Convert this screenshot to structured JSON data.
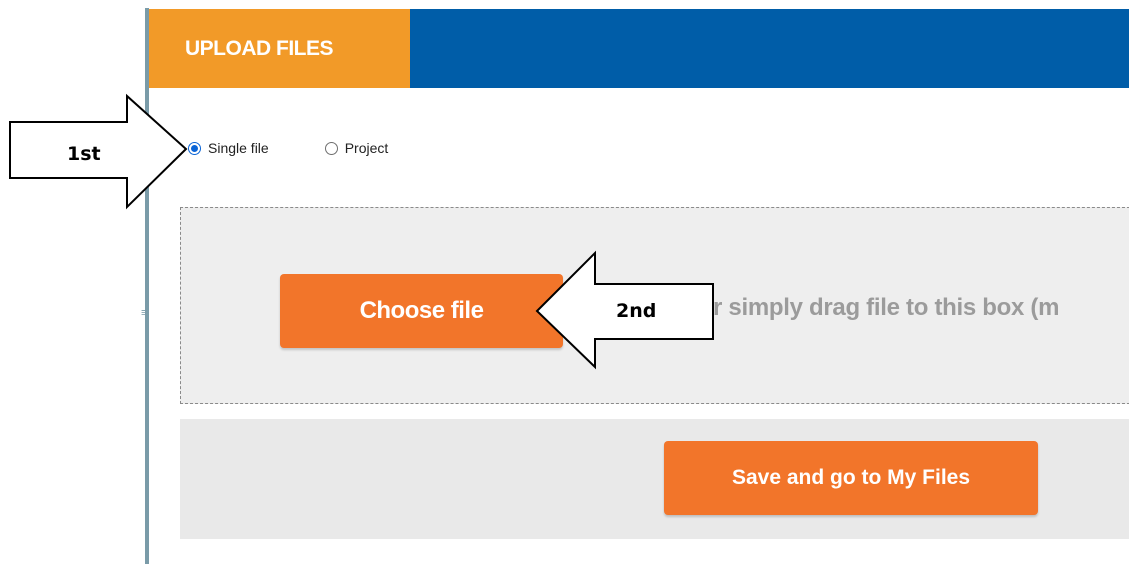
{
  "header": {
    "tab_label": "UPLOAD FILES"
  },
  "upload_type": {
    "options": [
      {
        "label": "Single file",
        "checked": true
      },
      {
        "label": "Project",
        "checked": false
      }
    ]
  },
  "drop_zone": {
    "choose_button_label": "Choose file",
    "drag_text": "r simply drag file to this box (m"
  },
  "footer": {
    "save_button_label": "Save and go to My Files"
  },
  "annotations": {
    "first_label": "1st",
    "second_label": "2nd"
  },
  "colors": {
    "header_blue": "#005da8",
    "tab_orange": "#f29a28",
    "button_orange": "#f2752a",
    "radio_selected": "#0a64d6"
  }
}
